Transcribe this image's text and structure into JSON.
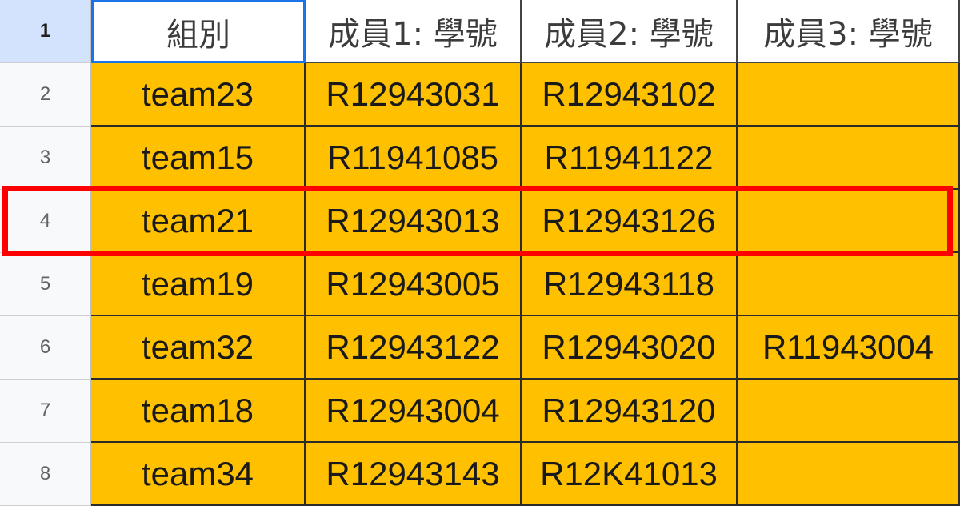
{
  "header": {
    "row_number": "1",
    "columns": [
      "組別",
      "成員1: 學號",
      "成員2: 學號",
      "成員3: 學號"
    ]
  },
  "rows": [
    {
      "num": "2",
      "cells": [
        "team23",
        "R12943031",
        "R12943102",
        ""
      ]
    },
    {
      "num": "3",
      "cells": [
        "team15",
        "R11941085",
        "R11941122",
        ""
      ]
    },
    {
      "num": "4",
      "cells": [
        "team21",
        "R12943013",
        "R12943126",
        ""
      ]
    },
    {
      "num": "5",
      "cells": [
        "team19",
        "R12943005",
        "R12943118",
        ""
      ]
    },
    {
      "num": "6",
      "cells": [
        "team32",
        "R12943122",
        "R12943020",
        "R11943004"
      ]
    },
    {
      "num": "7",
      "cells": [
        "team18",
        "R12943004",
        "R12943120",
        ""
      ]
    },
    {
      "num": "8",
      "cells": [
        "team34",
        "R12943143",
        "R12K41013",
        ""
      ]
    }
  ],
  "colors": {
    "cell_fill": "#ffc000",
    "highlight_border": "#ff0000",
    "selected_border": "#1a73e8"
  }
}
